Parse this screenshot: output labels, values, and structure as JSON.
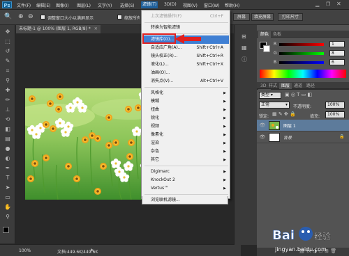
{
  "menubar": {
    "items": [
      "文件(F)",
      "编辑(E)",
      "图像(I)",
      "图层(L)",
      "文字(Y)",
      "选择(S)",
      "滤镜(T)",
      "3D(D)",
      "视图(V)",
      "窗口(W)",
      "帮助(H)"
    ],
    "active_item": "滤镜(T)"
  },
  "options": {
    "resize_label": "调整窗口大小以满屏显示",
    "zoom_all_label": "缩放所有",
    "fill_screen": "填充屏幕",
    "print_size": "打印尺寸",
    "actual": "屏幕"
  },
  "document": {
    "tab_title": "未标题-1 @ 100% (图层 1, RGB/8) *"
  },
  "status": {
    "zoom": "100%",
    "doc_info": "文档:449.6K/449.6K"
  },
  "filter_menu": {
    "items": [
      {
        "label": "上次滤镜操作(F)",
        "shortcut": "Ctrl+F",
        "disabled": true
      },
      {
        "label": "转换为智能滤镜"
      },
      {
        "label": "滤镜库(G)...",
        "highlighted": true
      },
      {
        "label": "自适应广角(A)...",
        "shortcut": "Shift+Ctrl+A"
      },
      {
        "label": "镜头校正(R)...",
        "shortcut": "Shift+Ctrl+R"
      },
      {
        "label": "液化(L)...",
        "shortcut": "Shift+Ctrl+X"
      },
      {
        "label": "油画(O)..."
      },
      {
        "label": "消失点(V)...",
        "shortcut": "Alt+Ctrl+V"
      },
      {
        "label": "风格化",
        "submenu": true
      },
      {
        "label": "模糊",
        "submenu": true
      },
      {
        "label": "扭曲",
        "submenu": true
      },
      {
        "label": "锐化",
        "submenu": true
      },
      {
        "label": "视频",
        "submenu": true
      },
      {
        "label": "像素化",
        "submenu": true
      },
      {
        "label": "渲染",
        "submenu": true
      },
      {
        "label": "杂色",
        "submenu": true
      },
      {
        "label": "其它",
        "submenu": true
      },
      {
        "label": "Digimarc",
        "submenu": true
      },
      {
        "label": "KnockOut 2",
        "submenu": true
      },
      {
        "label": "Vertus™",
        "submenu": true
      },
      {
        "label": "浏览联机滤镜..."
      }
    ]
  },
  "color_panel": {
    "tabs": [
      "颜色",
      "色板"
    ],
    "r_label": "R",
    "g_label": "G",
    "b_label": "B",
    "r_value": "1",
    "g_value": "8",
    "b_value": "6"
  },
  "layers_panel": {
    "tabs": [
      "3D",
      "图层",
      "通道",
      "路径"
    ],
    "kind_label": "类型",
    "blend_mode": "正常",
    "opacity_label": "不透明度:",
    "opacity_value": "100%",
    "lock_label": "锁定:",
    "fill_label": "填充:",
    "fill_value": "100%",
    "layers": [
      {
        "name": "图层 1",
        "selected": true
      },
      {
        "name": "背景",
        "italic": true
      }
    ]
  },
  "adjust_tabs": [
    "调整",
    "样式"
  ],
  "watermark": {
    "brand": "Baidu 经验",
    "url": "jingyan.baidu.com"
  },
  "colors": {
    "highlight": "#3f7fd3",
    "callout_red": "#e02020",
    "menu_bg": "#f0f0f0",
    "layer_selected": "#5d7b9b"
  }
}
